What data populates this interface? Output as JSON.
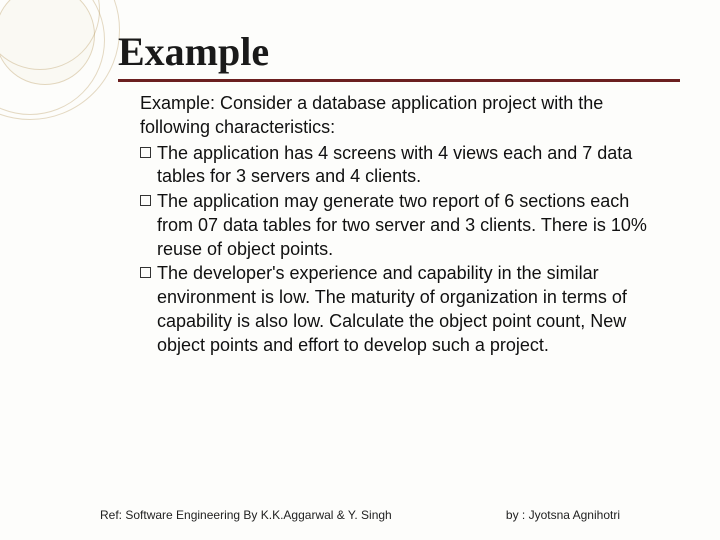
{
  "title": "Example",
  "intro": "Example: Consider a database application project with the following characteristics:",
  "bullets": [
    "The application has 4 screens with 4 views each and 7 data tables for 3 servers and 4 clients.",
    "The application may generate two report of 6 sections each from 07 data tables for two server and 3 clients. There is 10% reuse of object points.",
    "The developer's experience and capability in the similar environment is low. The maturity of organization in terms of capability is also low. Calculate the object point count, New object points and effort to develop such a project."
  ],
  "footer": {
    "left": "Ref: Software Engineering By K.K.Aggarwal & Y. Singh",
    "right": "by : Jyotsna Agnihotri"
  }
}
